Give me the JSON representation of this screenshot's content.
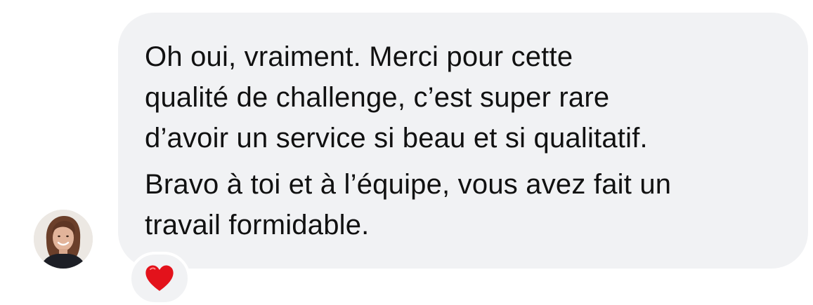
{
  "message": {
    "paragraphs": [
      {
        "lines": [
          "Oh oui, vraiment. Merci pour cette",
          "qualité de challenge, c’est super rare",
          "d’avoir un service si beau et si qualitatif."
        ]
      },
      {
        "lines": [
          "Bravo à toi et à l’équipe, vous avez fait un",
          "travail formidable."
        ]
      }
    ],
    "reaction": {
      "icon": "red-heart-icon",
      "color": "#e3121b"
    }
  },
  "sender": {
    "avatar_icon": "avatar"
  },
  "colors": {
    "bubble": "#f1f2f4",
    "text": "#111111"
  }
}
